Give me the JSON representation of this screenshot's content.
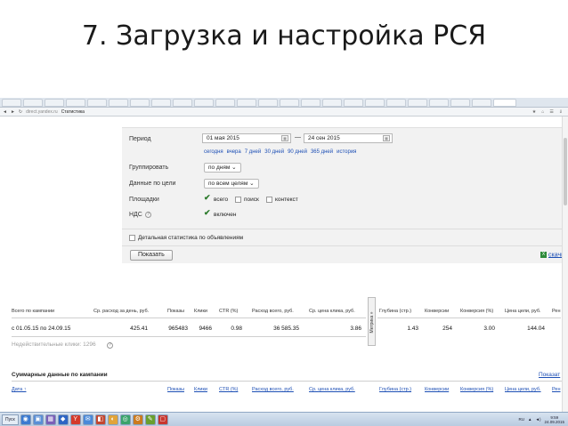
{
  "slide": {
    "title": "7. Загрузка и настройка РСЯ"
  },
  "browser": {
    "tabs": [
      "",
      "",
      "",
      "",
      "",
      "",
      "",
      "",
      "",
      "",
      "",
      "",
      "",
      "",
      "",
      "",
      "",
      "",
      "",
      "",
      "",
      "",
      "",
      "",
      "",
      "",
      ""
    ],
    "url": "direct.yandex.ru",
    "page_name": "Статистика",
    "right_icons": [
      "★",
      "⌂",
      "☰",
      "⇓"
    ]
  },
  "filters": {
    "period_label": "Период",
    "date_from": "01 мая 2015",
    "date_to": "24 сен 2015",
    "date_sep": "—",
    "quick_periods": [
      "сегодня",
      "вчера",
      "7 дней",
      "30 дней",
      "90 дней",
      "365 дней",
      "история"
    ],
    "group_label": "Группировать",
    "group_value": "по дням",
    "goals_label": "Данные по цели",
    "goals_value": "по всем целям",
    "platforms_label": "Площадки",
    "platforms": [
      "всего",
      "поиск",
      "контекст"
    ],
    "vat_label": "НДС",
    "vat_value": "включен",
    "detailed_label": "Детальная статистика по объявлениям",
    "show_button": "Показать",
    "xls_link": "скачи"
  },
  "metrika_tab": "Метрика »",
  "results_table": {
    "headers": [
      "Всего по кампании",
      "Ср. расход за день, руб.",
      "Показы",
      "Клики",
      "CTR (%)",
      "Расход всего, руб.",
      "Ср. цена клика, руб.",
      "Глубина (стр.)",
      "Конверсии",
      "Конверсия (%)",
      "Цена цели, руб.",
      "Рен"
    ],
    "row": [
      "с 01.05.15 по 24.09.15",
      "425.41",
      "965483",
      "9466",
      "0.98",
      "36 585.35",
      "3.86",
      "1.43",
      "254",
      "3.00",
      "144.04"
    ],
    "invalid_clicks": "Недействительные клики: 1296"
  },
  "summary": {
    "title": "Суммарные данные по кампании",
    "link": "Показат",
    "headers": [
      "Дата ↑",
      "Показы",
      "Клики",
      "CTR (%)",
      "Расход всего, руб.",
      "Ср. цена клика, руб.",
      "Глубина (стр.)",
      "Конверсии",
      "Конверсия (%)",
      "Цена цели, руб.",
      "Рен"
    ]
  },
  "taskbar": {
    "start": "Пуск",
    "icons": [
      "◉",
      "▣",
      "▦",
      "◆",
      "Y",
      "✉",
      "◧",
      "◐",
      "◎",
      "⚙",
      "✎",
      "▢"
    ],
    "tray_lang": "RU",
    "time": "9:59",
    "date": "24.09.2015"
  },
  "colors": {
    "link": "#1d4fb5",
    "panel": "#f2f2f2",
    "check": "#2b7a2b"
  }
}
